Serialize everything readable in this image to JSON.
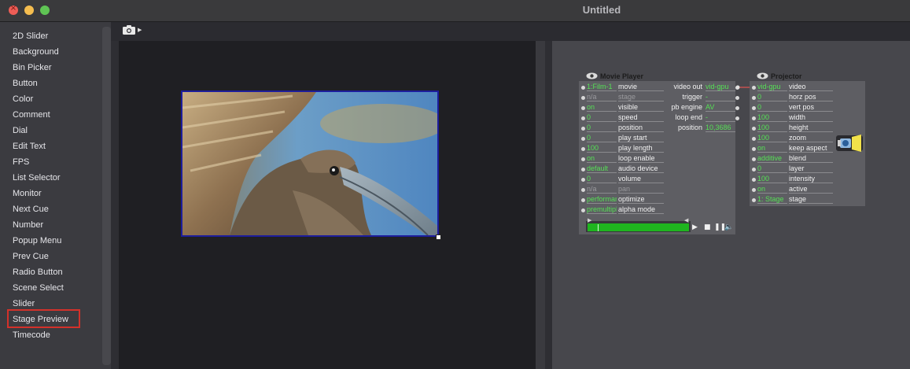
{
  "window": {
    "title": "Untitled"
  },
  "sidebar": {
    "selected": "Stage Preview",
    "items": [
      "2D Slider",
      "Background",
      "Bin Picker",
      "Button",
      "Color",
      "Comment",
      "Dial",
      "Edit Text",
      "FPS",
      "List Selector",
      "Monitor",
      "Next Cue",
      "Number",
      "Popup Menu",
      "Prev Cue",
      "Radio Button",
      "Scene Select",
      "Slider",
      "Stage Preview",
      "Timecode"
    ]
  },
  "toolbar": {
    "snapshot_icon": "camera-icon"
  },
  "colors": {
    "highlight": "#d3312a",
    "value_text": "#55e055",
    "progress": "#1fb51f",
    "stage_border": "#1d1d9c"
  },
  "movie_player": {
    "title": "Movie Player",
    "inputs": [
      {
        "value": "1:Film-1",
        "label": "movie"
      },
      {
        "value": "n/a",
        "label": "stage",
        "dim": true
      },
      {
        "value": "on",
        "label": "visible"
      },
      {
        "value": "0",
        "label": "speed"
      },
      {
        "value": "0",
        "label": "position"
      },
      {
        "value": "0",
        "label": "play start"
      },
      {
        "value": "100",
        "label": "play length"
      },
      {
        "value": "on",
        "label": "loop enable"
      },
      {
        "value": "default",
        "label": "audio device"
      },
      {
        "value": "0",
        "label": "volume"
      },
      {
        "value": "n/a",
        "label": "pan",
        "dim": true
      },
      {
        "value": "performance",
        "label": "optimize"
      },
      {
        "value": "premultiplied",
        "label": "alpha mode"
      }
    ],
    "outputs": [
      {
        "label": "video out",
        "value": "vid-gpu"
      },
      {
        "label": "trigger",
        "value": "-"
      },
      {
        "label": "pb engine",
        "value": "AV"
      },
      {
        "label": "loop end",
        "value": "-"
      },
      {
        "label": "position",
        "value": "10,3686"
      }
    ],
    "playback_progress": 1.0
  },
  "projector": {
    "title": "Projector",
    "inputs": [
      {
        "value": "vid-gpu",
        "label": "video"
      },
      {
        "value": "0",
        "label": "horz pos"
      },
      {
        "value": "0",
        "label": "vert pos"
      },
      {
        "value": "100",
        "label": "width"
      },
      {
        "value": "100",
        "label": "height"
      },
      {
        "value": "100",
        "label": "zoom"
      },
      {
        "value": "on",
        "label": "keep aspect"
      },
      {
        "value": "additive",
        "label": "blend"
      },
      {
        "value": "0",
        "label": "layer"
      },
      {
        "value": "100",
        "label": "intensity"
      },
      {
        "value": "on",
        "label": "active"
      },
      {
        "value": "1: Stage",
        "label": "stage"
      }
    ]
  }
}
